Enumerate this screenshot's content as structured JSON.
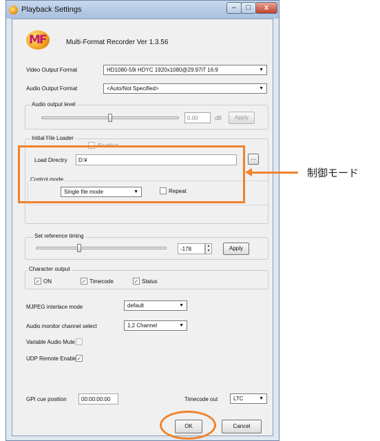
{
  "window": {
    "title": "Playback Settings",
    "min": "–",
    "max": "□",
    "close": "x"
  },
  "header": {
    "logo_text": "MF",
    "product": "Multi-Format Recorder  Ver 1.3.56"
  },
  "video_output": {
    "label": "Video Output Format",
    "value": "HD1080-59i HDYC 1920x1080@29.97iT 16:9"
  },
  "audio_output": {
    "label": "Audio Output Format",
    "value": "<Auto/Not Specified>"
  },
  "audio_level": {
    "title": "Audio output level",
    "value": "0.00",
    "unit": "dB",
    "apply": "Apply",
    "slider_fraction": 0.5
  },
  "file_loader": {
    "title": "Initial File Loader",
    "enabled_label": "Enabled",
    "dir_label": "Load Directry",
    "dir_value": "D:¥",
    "browse": "..."
  },
  "control_mode": {
    "title": "Control mode",
    "value": "Single file mode",
    "repeat_label": "Repeat"
  },
  "reference_timing": {
    "title": "Set reference timing",
    "value": "-178",
    "apply": "Apply",
    "slider_fraction": 0.33
  },
  "character_output": {
    "title": "Character output",
    "items": [
      {
        "label": "ON",
        "checked": true
      },
      {
        "label": "Timecode",
        "checked": true
      },
      {
        "label": "Status",
        "checked": true
      }
    ]
  },
  "mjpeg": {
    "label": "MJPEG interlace mode",
    "value": "default"
  },
  "audio_monitor": {
    "label": "Audio monitor channel select",
    "value": "1,2 Channel"
  },
  "variable_audio_mute": {
    "label": "Variable Audio Mute",
    "checked": false
  },
  "udp_remote": {
    "label": "UDP Remote Enable",
    "checked": true
  },
  "gpi_cue": {
    "label": "GPI cue position",
    "value": "00:00:00:00"
  },
  "timecode_out": {
    "label": "Timecode out",
    "value": "LTC"
  },
  "buttons": {
    "ok": "OK",
    "cancel": "Cancel"
  },
  "annotation": {
    "text": "制御モード",
    "color": "#f0822b"
  }
}
